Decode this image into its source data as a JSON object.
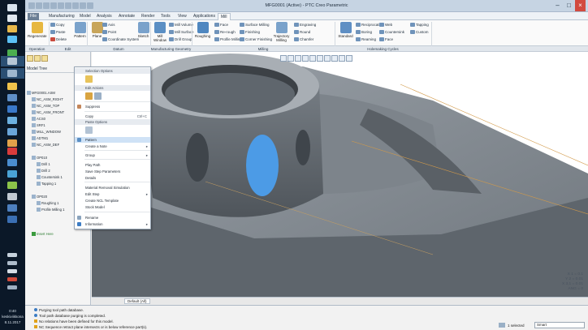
{
  "window": {
    "title": "MFG0001 (Active) - PTC Creo Parametric"
  },
  "menu_tabs": [
    {
      "label": "File"
    },
    {
      "label": "Manufacturing"
    },
    {
      "label": "Model"
    },
    {
      "label": "Analysis"
    },
    {
      "label": "Annotate"
    },
    {
      "label": "Render"
    },
    {
      "label": "Tools"
    },
    {
      "label": "View"
    },
    {
      "label": "Applications"
    },
    {
      "label": "Mill"
    }
  ],
  "ribbon": {
    "operation": {
      "regenerate": "Regenerate"
    },
    "edit": {
      "copy": "Copy",
      "paste": "Paste",
      "delete": "Delete",
      "pattern": "Pattern"
    },
    "datum": {
      "plane": "Plane",
      "axis": "Axis",
      "point": "Point",
      "coordinate_system": "Coordinate System",
      "sketch": "Sketch"
    },
    "mfg_geometry": {
      "mill_window": "Mill Window",
      "mill_volume": "Mill Volume",
      "mill_surface": "Mill Surface",
      "drill_group": "Drill Group"
    },
    "milling": {
      "roughing": "Roughing",
      "face": "Face",
      "re_rough": "Re-rough",
      "profile_milling": "Profile Milling",
      "surface_milling": "Surface Milling",
      "finishing": "Finishing",
      "corner_finishing": "Corner Finishing",
      "trajectory_milling": "Trajectory Milling",
      "engraving": "Engraving",
      "round": "Round",
      "chamfer": "Chamfer"
    },
    "holemaking": {
      "standard": "Standard",
      "reciprocating_labels": [
        "Reciprocating"
      ],
      "boring": "Boring",
      "reaming": "Reaming",
      "web": "Web",
      "countersink": "Countersink",
      "face": "Face",
      "tapping": "Tapping",
      "custom": "Custom"
    },
    "groups": [
      "Operation",
      "Edit",
      "Datum",
      "Manufacturing Geometry",
      "Milling",
      "Holemaking Cycles"
    ]
  },
  "model_tree": {
    "tab": "Model Tree",
    "rows": [
      "MFG0001.ASM",
      "NC_ASM_RIGHT",
      "NC_ASM_TOP",
      "NC_ASM_FRONT",
      "ACS0",
      "SRF1",
      "MILL_WINDOW",
      "ADTM1",
      "NC_ASM_DEF",
      "OP010",
      "Drill 1",
      "Drill 2",
      "Countersink 1",
      "Tapping 1",
      "OP020",
      "Roughing 1",
      "Profile Milling 1",
      "Insert Here"
    ]
  },
  "context_menu": {
    "header1": "Selection Options",
    "header2": "Edit Actions",
    "suppress": "Suppress",
    "copy": "Copy",
    "copy_shortcut": "Ctrl+C",
    "header3": "Paste Options",
    "pattern": "Pattern",
    "create_note": "Create a Note",
    "group": "Group",
    "play_path": "Play Path",
    "save_step_params": "Save Step Parameters",
    "details": "Details",
    "material_removal": "Material Removal Simulation",
    "edit_step": "Edit Step",
    "create_nc_template": "Create NCL Template",
    "stock_model": "Stock Model",
    "rename": "Rename",
    "information": "Information"
  },
  "viewport": {
    "coords": [
      "X 1 = 0.1",
      "Y 2 = 0.01",
      "X 3,1 = 0.01",
      "ANG = 0"
    ]
  },
  "status_strip": {
    "default_label": "Default (All)"
  },
  "messages": [
    {
      "type": "info",
      "text": "Purging tool path database."
    },
    {
      "type": "info",
      "text": "Tool path database purging is completed."
    },
    {
      "type": "warn",
      "text": "No relations have been defined for this model."
    },
    {
      "type": "warn",
      "text": "NC Sequence retract plane intersects or is below reference part(s)."
    }
  ],
  "selection": {
    "count_label": "1 selected",
    "filter_value": "Smart"
  },
  "tray": {
    "time": "0:40",
    "day": "keskiviikkona",
    "date": "8.11.2017"
  },
  "colors": {
    "part_gray": "#8a9096",
    "part_dark": "#5a6066",
    "highlight_blue": "#4c9be6",
    "accent_ribbon": "#6b7f95"
  }
}
